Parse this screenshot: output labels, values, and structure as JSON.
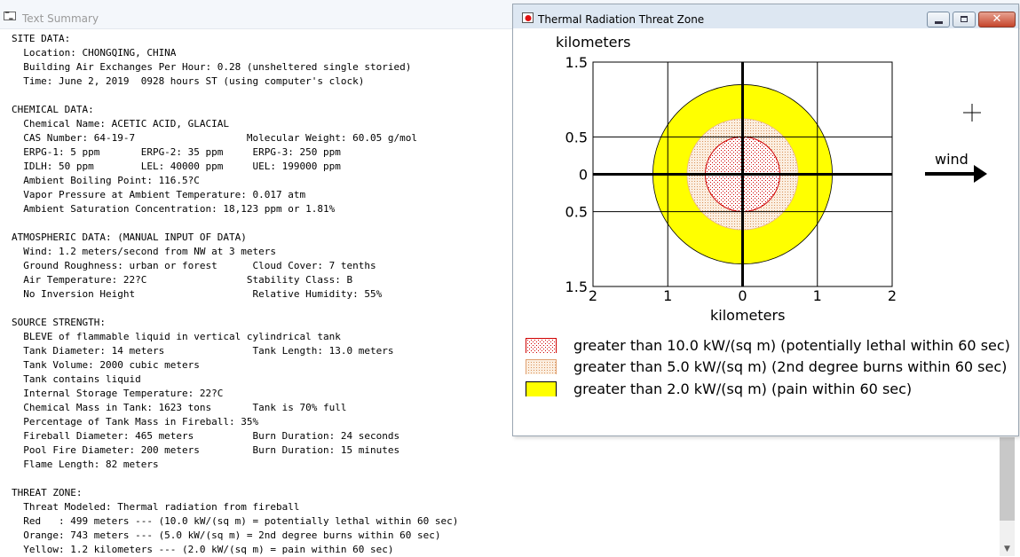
{
  "text_summary": {
    "title": "Text Summary",
    "icon": "window-app-icon",
    "lines": [
      "SITE DATA:",
      "  Location: CHONGQING, CHINA",
      "  Building Air Exchanges Per Hour: 0.28 (unsheltered single storied)",
      "  Time: June 2, 2019  0928 hours ST (using computer's clock)",
      "",
      "CHEMICAL DATA:",
      "  Chemical Name: ACETIC ACID, GLACIAL",
      "  CAS Number: 64-19-7                   Molecular Weight: 60.05 g/mol",
      "  ERPG-1: 5 ppm       ERPG-2: 35 ppm     ERPG-3: 250 ppm",
      "  IDLH: 50 ppm        LEL: 40000 ppm     UEL: 199000 ppm",
      "  Ambient Boiling Point: 116.5?C",
      "  Vapor Pressure at Ambient Temperature: 0.017 atm",
      "  Ambient Saturation Concentration: 18,123 ppm or 1.81%",
      "",
      "ATMOSPHERIC DATA: (MANUAL INPUT OF DATA)",
      "  Wind: 1.2 meters/second from NW at 3 meters",
      "  Ground Roughness: urban or forest      Cloud Cover: 7 tenths",
      "  Air Temperature: 22?C                 Stability Class: B",
      "  No Inversion Height                    Relative Humidity: 55%",
      "",
      "SOURCE STRENGTH:",
      "  BLEVE of flammable liquid in vertical cylindrical tank",
      "  Tank Diameter: 14 meters               Tank Length: 13.0 meters",
      "  Tank Volume: 2000 cubic meters",
      "  Tank contains liquid",
      "  Internal Storage Temperature: 22?C",
      "  Chemical Mass in Tank: 1623 tons       Tank is 70% full",
      "  Percentage of Tank Mass in Fireball: 35%",
      "  Fireball Diameter: 465 meters          Burn Duration: 24 seconds",
      "  Pool Fire Diameter: 200 meters         Burn Duration: 15 minutes",
      "  Flame Length: 82 meters",
      "",
      "THREAT ZONE:",
      "  Threat Modeled: Thermal radiation from fireball",
      "  Red   : 499 meters --- (10.0 kW/(sq m) = potentially lethal within 60 sec)",
      "  Orange: 743 meters --- (5.0 kW/(sq m) = 2nd degree burns within 60 sec)",
      "  Yellow: 1.2 kilometers --- (2.0 kW/(sq m) = pain within 60 sec)"
    ]
  },
  "threat_window": {
    "title": "Thermal Radiation Threat Zone",
    "icon": "threat-zone-app-icon",
    "buttons": {
      "minimize": "minimize-icon",
      "maximize": "maximize-icon",
      "close_label": "✕"
    },
    "plot": {
      "y_unit_label": "kilometers",
      "x_unit_label": "kilometers",
      "x_ticks": [
        "2",
        "1",
        "0",
        "1",
        "2"
      ],
      "y_ticks": [
        "1.5",
        "0.5",
        "0",
        "0.5",
        "1.5"
      ],
      "x_tick_values": [
        -2,
        -1,
        0,
        1,
        2
      ],
      "y_tick_values": [
        1.5,
        0.5,
        0,
        -0.5,
        -1.5
      ],
      "x_range": [
        -2,
        2
      ],
      "y_range": [
        -1.5,
        1.5
      ],
      "grid": true,
      "zones": [
        {
          "name": "yellow",
          "radius_km": 1.2,
          "fill": "#ffff00",
          "stroke": "#000000"
        },
        {
          "name": "orange",
          "radius_km": 0.743,
          "fill": "#f5dcc0",
          "stroke": "#e8b48a"
        },
        {
          "name": "red",
          "radius_km": 0.499,
          "fill": "#ffe8e8",
          "stroke": "#d00000"
        }
      ],
      "wind_label": "wind",
      "wind_icon": "wind-arrow-icon",
      "cursor_icon": "crosshair-cursor-icon"
    },
    "legend": [
      {
        "label": "greater than 10.0 kW/(sq m) (potentially lethal within 60 sec)",
        "swatch": "red-dotted",
        "color": "#d00000"
      },
      {
        "label": "greater than 5.0 kW/(sq m) (2nd degree burns within 60 sec)",
        "swatch": "orange-dotted",
        "color": "#e8a060"
      },
      {
        "label": "greater than 2.0 kW/(sq m) (pain within 60 sec)",
        "swatch": "yellow-solid",
        "color": "#ffff00"
      }
    ]
  }
}
